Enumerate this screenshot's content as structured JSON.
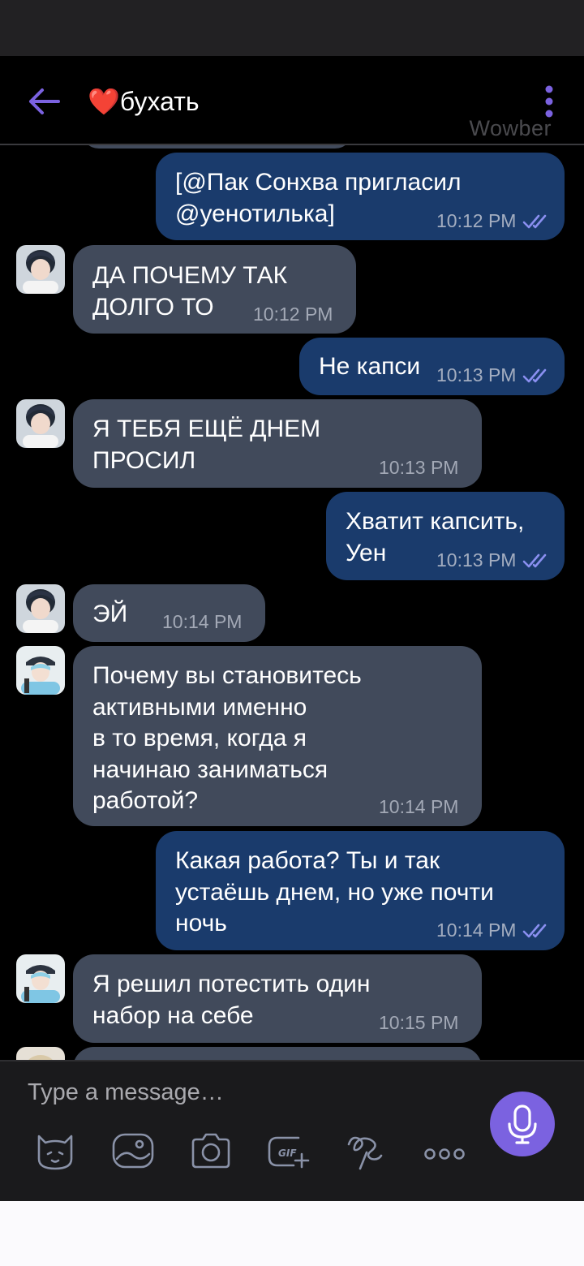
{
  "header": {
    "title": "❤️бухать",
    "watermark": "Wowber"
  },
  "colors": {
    "accent": "#7b62e0",
    "incoming_bubble": "#414a5b",
    "outgoing_bubble": "#1a3b6c",
    "read_ticks": "#8a8ff0"
  },
  "messages": [
    {
      "direction": "out",
      "text": "[@Пак Сонхва пригласил\n@уенотилька]",
      "time": "10:12 PM",
      "read": true
    },
    {
      "direction": "in",
      "avatar": "avatar-1",
      "text": "ДА ПОЧЕМУ ТАК\nДОЛГО ТО",
      "time": "10:12 PM"
    },
    {
      "direction": "out",
      "text": "Не капси",
      "time": "10:13 PM",
      "read": true
    },
    {
      "direction": "in",
      "avatar": "avatar-1",
      "text": "Я ТЕБЯ ЕЩЁ ДНЕМ\nПРОСИЛ",
      "time": "10:13 PM"
    },
    {
      "direction": "out",
      "text": "Хватит капсить,\nУен",
      "time": "10:13 PM",
      "read": true
    },
    {
      "direction": "in",
      "avatar": "avatar-1",
      "text": "ЭЙ",
      "time": "10:14 PM"
    },
    {
      "direction": "in",
      "avatar": "avatar-2",
      "text": "Почему вы становитесь\nактивными именно\nв то время, когда я\nначинаю заниматься\nработой?",
      "time": "10:14 PM"
    },
    {
      "direction": "out",
      "text": "Какая работа? Ты и так\nустаёшь днем, но уже почти\nночь",
      "time": "10:14 PM",
      "read": true
    },
    {
      "direction": "in",
      "avatar": "avatar-2",
      "text": "Я решил потестить один\nнабор на себе",
      "time": "10:15 PM"
    }
  ],
  "composer": {
    "placeholder": "Type a message…",
    "tools": [
      "sticker-icon",
      "gallery-icon",
      "camera-icon",
      "gif-icon",
      "doodle-icon",
      "more-icon"
    ],
    "gif_label": "GIF"
  }
}
